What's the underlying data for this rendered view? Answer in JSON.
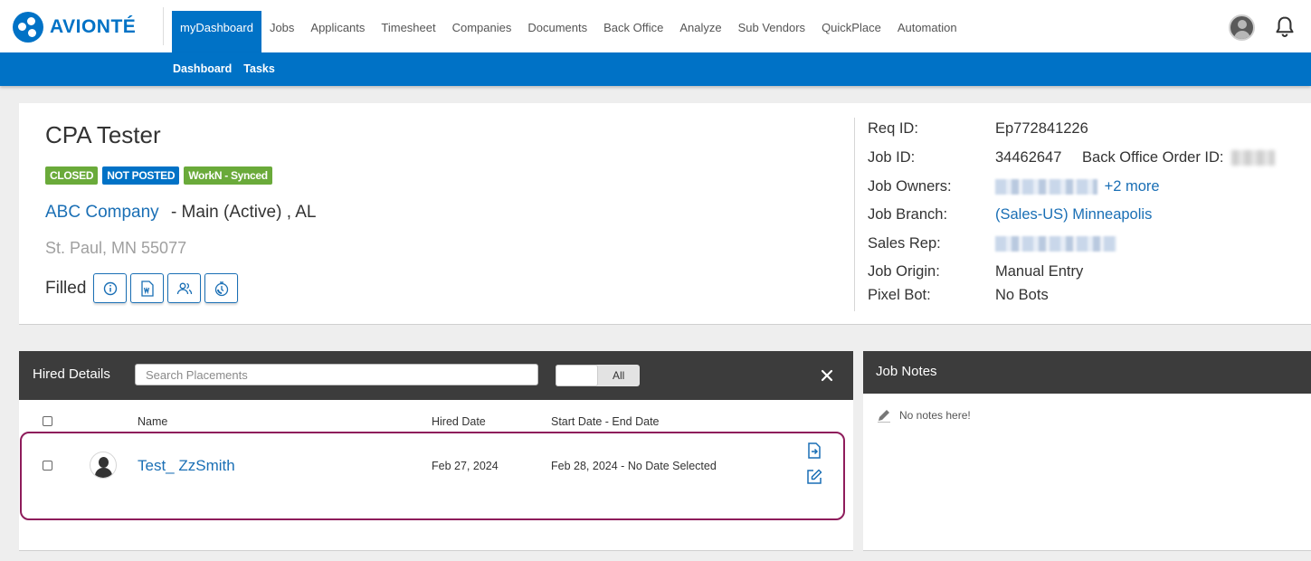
{
  "brand": {
    "name": "AVIONTÉ"
  },
  "nav": {
    "items": [
      "myDashboard",
      "Jobs",
      "Applicants",
      "Timesheet",
      "Companies",
      "Documents",
      "Back Office",
      "Analyze",
      "Sub Vendors",
      "QuickPlace",
      "Automation"
    ],
    "active": "myDashboard"
  },
  "subnav": {
    "items": [
      "Dashboard",
      "Tasks"
    ]
  },
  "job": {
    "title": "CPA Tester",
    "badges": [
      "CLOSED",
      "NOT POSTED",
      "WorkN - Synced"
    ],
    "company": "ABC Company",
    "company_detail": "- Main (Active) , AL",
    "address": "St. Paul, MN 55077",
    "status": "Filled",
    "action_icons": [
      "info-icon",
      "word-document-icon",
      "users-icon",
      "timer-icon"
    ]
  },
  "details": {
    "req_id_label": "Req ID:",
    "req_id": "Ep772841226",
    "job_id_label": "Job ID:",
    "job_id": "34462647",
    "back_office_label": "Back Office Order ID:",
    "job_owners_label": "Job Owners:",
    "job_owners_more": "+2 more",
    "job_branch_label": "Job Branch:",
    "job_branch": "(Sales-US) Minneapolis",
    "sales_rep_label": "Sales Rep:",
    "job_origin_label": "Job Origin:",
    "job_origin": "Manual Entry",
    "pixel_bot_label": "Pixel Bot:",
    "pixel_bot": "No Bots"
  },
  "hired": {
    "title": "Hired Details",
    "search_placeholder": "Search Placements",
    "filter_label": "All",
    "columns": {
      "name": "Name",
      "hired_date": "Hired Date",
      "dates": "Start Date - End Date"
    },
    "rows": [
      {
        "name": "Test_ ZzSmith",
        "hired_date": "Feb 27, 2024",
        "start_date": "Feb 28, 2024",
        "separator": "-",
        "end_date": "No Date Selected"
      }
    ]
  },
  "notes": {
    "title": "Job Notes",
    "empty_text": "No notes here!"
  },
  "colors": {
    "brand_blue": "#0072c6",
    "link_blue": "#1a6fb5",
    "badge_green": "#6aaa3a",
    "panel_header": "#3c3c3c",
    "highlight_border": "#8e1c5b"
  }
}
